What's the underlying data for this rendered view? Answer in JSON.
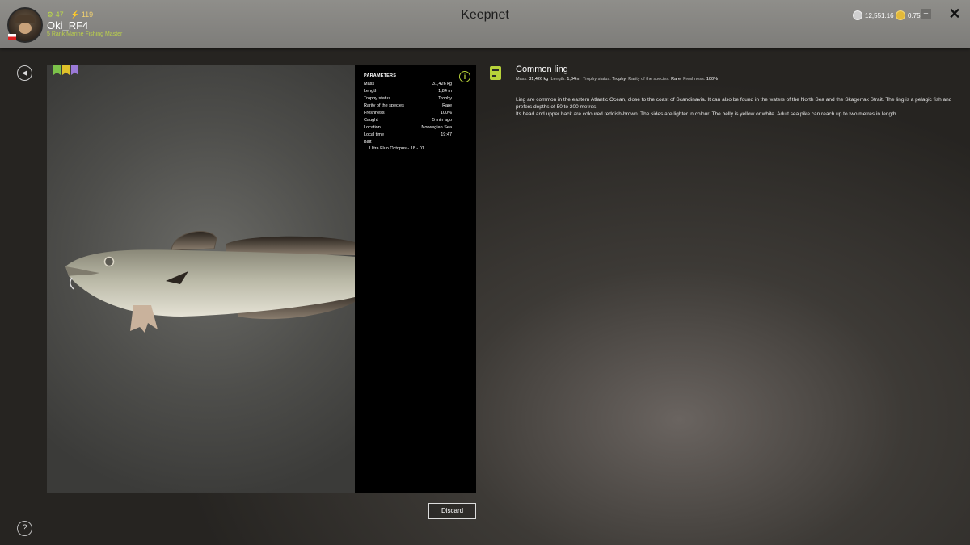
{
  "header": {
    "title": "Keepnet",
    "user": {
      "level": "47",
      "level_color": "#b7d23a",
      "points": "119",
      "name": "Oki_RF4",
      "rank": "5 Rank Marine Fishing Master"
    },
    "currency": [
      {
        "value": "12,551.16",
        "icon": "silver-coin-icon"
      },
      {
        "value": "0.75",
        "icon": "gold-coin-icon"
      }
    ],
    "add_label": "+",
    "close_label": "✕"
  },
  "ribbons": [
    {
      "color": "#7cc24a",
      "icon": "green-ribbon-icon"
    },
    {
      "color": "#e0c22a",
      "icon": "yellow-ribbon-icon"
    },
    {
      "color": "#9b7ad8",
      "icon": "purple-ribbon-icon"
    }
  ],
  "parameters": {
    "heading": "PARAMETERS",
    "info_icon": "i",
    "rows": [
      {
        "label": "Mass",
        "value": "31,426 kg"
      },
      {
        "label": "Length",
        "value": "1,84 m"
      },
      {
        "label": "Trophy status",
        "value": "Trophy"
      },
      {
        "label": "Rarity of the species",
        "value": "Rare"
      },
      {
        "label": "Freshness",
        "value": "100%"
      },
      {
        "label": "Caught",
        "value": "5 min ago"
      },
      {
        "label": "Location",
        "value": "Norwegian Sea"
      },
      {
        "label": "Local time",
        "value": "19:47"
      }
    ],
    "bait_label": "Bait",
    "bait_value": "Ultra Fluo Octopus - 18 - 01"
  },
  "discard_label": "Discard",
  "fish": {
    "name": "Common ling",
    "summary": [
      {
        "label": "Mass:",
        "value": "31,426 kg"
      },
      {
        "label": "Length:",
        "value": "1,84 m"
      },
      {
        "label": "Trophy status:",
        "value": "Trophy"
      },
      {
        "label": "Rarity of the species:",
        "value": "Rare"
      },
      {
        "label": "Freshness:",
        "value": "100%"
      }
    ],
    "description_1": "Ling are common in the eastern Atlantic Ocean, close to the coast of Scandinavia. It can also be found in the waters of the North Sea and the Skagerrak Strait. The ling is a pelagic fish and prefers depths of 50 to 200 metres.",
    "description_2": "Its head and upper back are coloured reddish-brown. The sides are lighter in colour. The belly is yellow or white. Adult sea pike can reach up to two metres in length."
  },
  "nav": {
    "back_icon": "back-arrow-icon",
    "help_icon": "help-icon",
    "help_label": "?"
  },
  "colors": {
    "accent": "#b7d23a",
    "panel_bg": "#000000",
    "topbar_bg": "#858481"
  }
}
